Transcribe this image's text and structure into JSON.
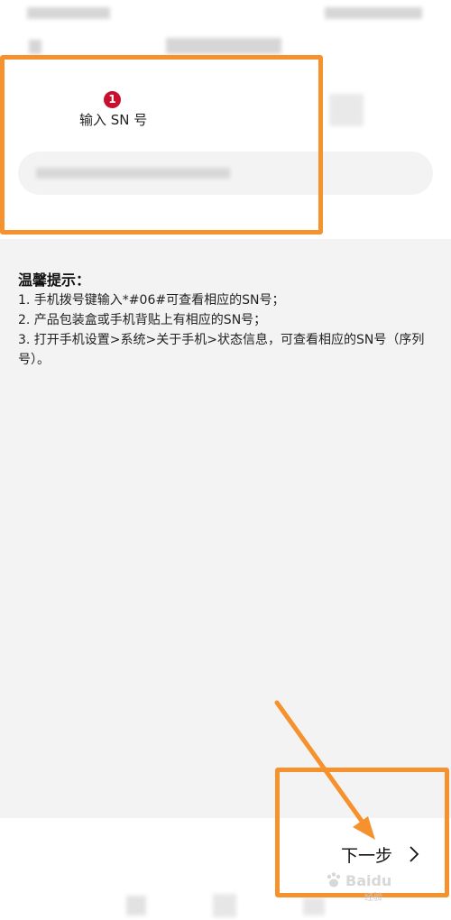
{
  "header": {
    "title": ""
  },
  "step": {
    "number": "1",
    "label": "输入 SN 号"
  },
  "sn_input": {
    "value": "",
    "placeholder": ""
  },
  "tips": {
    "title": "温馨提示：",
    "items": [
      "1. 手机拨号键输入*#06#可查看相应的SN号；",
      "2. 产品包装盒或手机背贴上有相应的SN号；",
      "3. 打开手机设置>系统>关于手机>状态信息，可查看相应的SN号（序列号）。"
    ]
  },
  "footer": {
    "next_label": "下一步",
    "next_icon": "chevron-right-icon"
  },
  "annotations": {
    "highlight_color": "#f5922e"
  },
  "colors": {
    "badge": "#c8102e",
    "tips_bg": "#f3f3f3",
    "accent": "#f5922e"
  },
  "watermark": {
    "brand": "Baidu",
    "sub": "经验"
  }
}
